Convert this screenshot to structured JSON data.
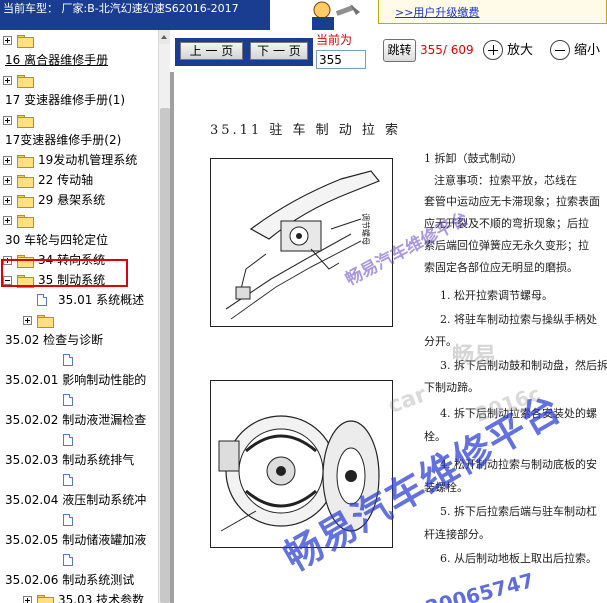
{
  "header": {
    "car_model_label": "当前车型： 厂家:B-北汽幻速幻速S62016-2017",
    "upgrade_link": ">>用户升级缴费"
  },
  "sidebar": {
    "items": [
      {
        "label": "",
        "level": 0,
        "icon": "folder"
      },
      {
        "label": "16 离合器维修手册",
        "level": 0,
        "icon": "none"
      },
      {
        "label": "",
        "level": 0,
        "icon": "folder"
      },
      {
        "label": "17 变速器维修手册(1)",
        "level": 0,
        "icon": "none"
      },
      {
        "label": "",
        "level": 0,
        "icon": "folder"
      },
      {
        "label": "17变速器维修手册(2)",
        "level": 0,
        "icon": "none"
      },
      {
        "label": "19发动机管理系统",
        "level": 0,
        "icon": "folder"
      },
      {
        "label": "22 传动轴",
        "level": 0,
        "icon": "folder"
      },
      {
        "label": "29 悬架系统",
        "level": 0,
        "icon": "folder"
      },
      {
        "label": "",
        "level": 0,
        "icon": "folder"
      },
      {
        "label": "30 车轮与四轮定位",
        "level": 0,
        "icon": "none"
      },
      {
        "label": "34 转向系统",
        "level": 0,
        "icon": "folder"
      },
      {
        "label": "35 制动系统",
        "level": 0,
        "icon": "folder-open"
      },
      {
        "label": "35.01 系统概述",
        "level": 1,
        "icon": "doc"
      },
      {
        "label": "",
        "level": 1,
        "icon": "folder"
      },
      {
        "label": "35.02 检查与诊断",
        "level": 0,
        "icon": "none"
      },
      {
        "label": "",
        "level": 2,
        "icon": "doc"
      },
      {
        "label": "35.02.01 影响制动性能的",
        "level": 0,
        "icon": "none"
      },
      {
        "label": "",
        "level": 2,
        "icon": "doc"
      },
      {
        "label": "35.02.02 制动液泄漏检查",
        "level": 0,
        "icon": "none"
      },
      {
        "label": "",
        "level": 2,
        "icon": "doc"
      },
      {
        "label": "35.02.03 制动系统排气",
        "level": 0,
        "icon": "none"
      },
      {
        "label": "",
        "level": 2,
        "icon": "doc"
      },
      {
        "label": "35.02.04 液压制动系统冲",
        "level": 0,
        "icon": "none"
      },
      {
        "label": "",
        "level": 2,
        "icon": "doc"
      },
      {
        "label": "35.02.05 制动储液罐加液",
        "level": 0,
        "icon": "none"
      },
      {
        "label": "",
        "level": 2,
        "icon": "doc"
      },
      {
        "label": "35.02.06 制动系统测试",
        "level": 0,
        "icon": "none"
      },
      {
        "label": "35.03 技术参数",
        "level": 1,
        "icon": "folder"
      },
      {
        "label": "",
        "level": 2,
        "icon": "doc"
      }
    ]
  },
  "toolbar": {
    "prev_label": "上 一 页",
    "next_label": "下 一 页",
    "current_label": "当前为",
    "page_value": "355",
    "goto_label": "跳转",
    "page_count": "355/ 609",
    "zoom_in_label": "放大",
    "zoom_out_label": "缩小"
  },
  "document": {
    "title": "35.11 驻 车 制 动 拉 索",
    "figure_label": "调节螺母",
    "lines": [
      "1 拆卸（鼓式制动）",
      "注意事项：拉索平放，芯线在",
      "套管中运动应无卡滞现象；拉索表面",
      "应无开裂及不顺的弯折现象；后拉",
      "索后端回位弹簧应无永久变形；拉",
      "索固定各部位应无明显的磨损。",
      "1. 松开拉索调节螺母。",
      "2. 将驻车制动拉索与操纵手柄处",
      "分开。",
      "3. 拆下后制动鼓和制动盘，然后拆",
      "下制动蹄。",
      "4. 拆下后制动拉索各安装处的螺",
      "栓。",
      "4. 松开制动拉索与制动底板的安",
      "装螺栓。",
      "5. 拆下后拉索后端与驻车制动杠",
      "杆连接部分。",
      "6. 从后制动地板上取出后拉索。"
    ]
  },
  "watermarks": {
    "main": "畅易汽车维修平台",
    "secondary": "畅易汽车维修平台",
    "faint_1": "畅易",
    "faint_2": "car",
    "faint_3": "2016c",
    "number": "20065747"
  },
  "colors": {
    "header_bg": "#1a3d92",
    "red_text": "#e00000",
    "watermark_blue": "#2a3fd0",
    "watermark_purple": "#6a4ac8"
  }
}
